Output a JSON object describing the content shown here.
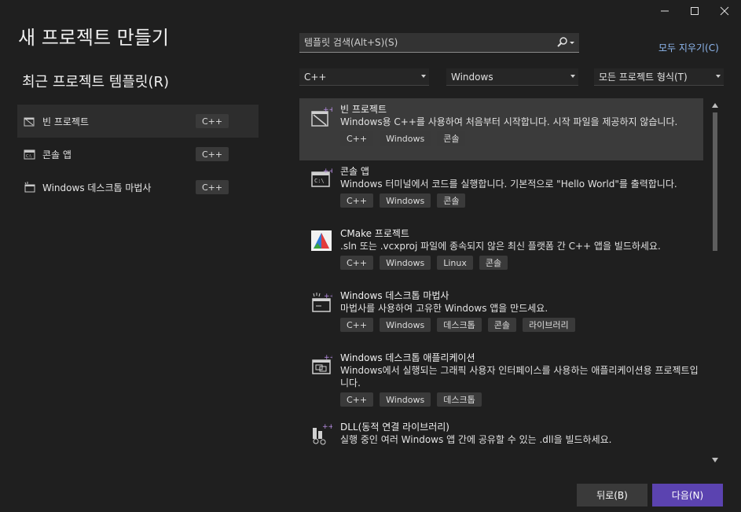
{
  "window": {
    "controls": [
      "minimize-icon",
      "maximize-icon",
      "close-icon"
    ]
  },
  "page_title": "새 프로젝트 만들기",
  "recent": {
    "title": "최근 프로젝트 템플릿(R)",
    "items": [
      {
        "label": "빈 프로젝트",
        "tag": "C++",
        "icon": "empty-project-icon",
        "selected": true
      },
      {
        "label": "콘솔 앱",
        "tag": "C++",
        "icon": "console-app-icon",
        "selected": false
      },
      {
        "label": "Windows 데스크톱 마법사",
        "tag": "C++",
        "icon": "desktop-wizard-icon",
        "selected": false
      }
    ]
  },
  "search": {
    "placeholder": "템플릿 검색(Alt+S)(S)",
    "value": ""
  },
  "clear_all": "모두 지우기(C)",
  "filters": {
    "language": "C++",
    "platform": "Windows",
    "project_type": "모든 프로젝트 형식(T)"
  },
  "templates": [
    {
      "name": "빈 프로젝트",
      "description": "Windows용 C++를 사용하여 처음부터 시작합니다. 시작 파일을 제공하지 않습니다.",
      "tags": [
        "C++",
        "Windows",
        "콘솔"
      ],
      "icon": "empty-project-icon",
      "selected": true
    },
    {
      "name": "콘솔 앱",
      "description": "Windows 터미널에서 코드를 실행합니다. 기본적으로 \"Hello World\"를 출력합니다.",
      "tags": [
        "C++",
        "Windows",
        "콘솔"
      ],
      "icon": "console-app-icon",
      "selected": false
    },
    {
      "name": "CMake 프로젝트",
      "description": ".sln 또는 .vcxproj 파일에 종속되지 않은 최신 플랫폼 간 C++ 앱을 빌드하세요.",
      "tags": [
        "C++",
        "Windows",
        "Linux",
        "콘솔"
      ],
      "icon": "cmake-icon",
      "selected": false
    },
    {
      "name": "Windows 데스크톱 마법사",
      "description": "마법사를 사용하여 고유한 Windows 앱을 만드세요.",
      "tags": [
        "C++",
        "Windows",
        "데스크톱",
        "콘솔",
        "라이브러리"
      ],
      "icon": "desktop-wizard-icon",
      "selected": false
    },
    {
      "name": "Windows 데스크톱 애플리케이션",
      "description": "Windows에서 실행되는 그래픽 사용자 인터페이스를 사용하는 애플리케이션용 프로젝트입니다.",
      "tags": [
        "C++",
        "Windows",
        "데스크톱"
      ],
      "icon": "desktop-app-icon",
      "selected": false
    },
    {
      "name": "DLL(동적 연결 라이브러리)",
      "description": "실행 중인 여러 Windows 앱 간에 공유할 수 있는 .dll을 빌드하세요.",
      "tags": [],
      "icon": "dll-icon",
      "selected": false
    }
  ],
  "buttons": {
    "back": "뒤로(B)",
    "next": "다음(N)"
  },
  "colors": {
    "accent": "#5b43b0",
    "link": "#8fb8f0",
    "selected_bg": "#3b3b3b"
  }
}
